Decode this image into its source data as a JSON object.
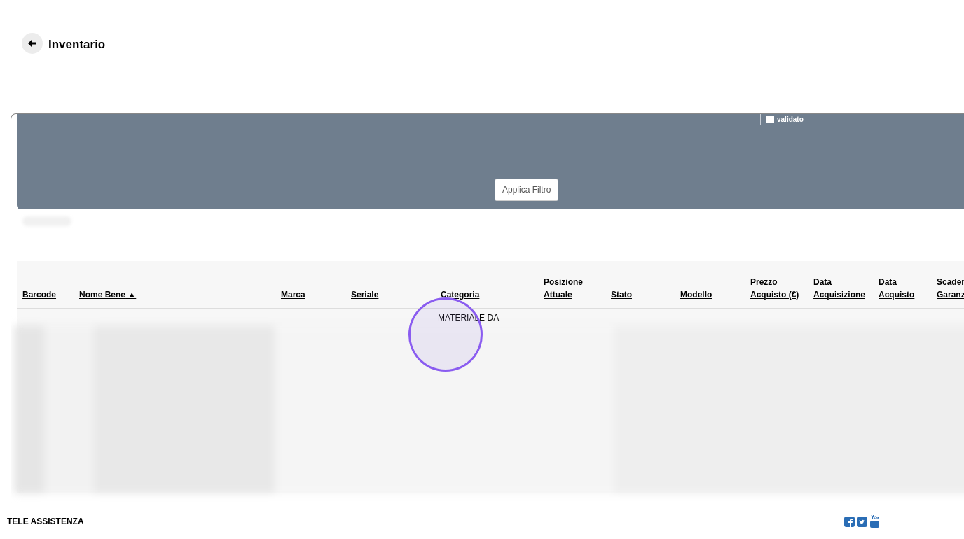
{
  "header": {
    "title": "Inventario"
  },
  "filter": {
    "checkbox": {
      "label": "validato",
      "checked": false
    },
    "apply_button": "Applica Filtro"
  },
  "table": {
    "columns": [
      {
        "lines": [
          "Barcode"
        ]
      },
      {
        "lines": [
          "Nome Bene"
        ],
        "sort_mark": "▲"
      },
      {
        "lines": [
          "Marca"
        ]
      },
      {
        "lines": [
          "Seriale"
        ]
      },
      {
        "lines": [
          "Categoria"
        ],
        "first_row_value": "MATERIALE DA"
      },
      {
        "lines": [
          "Posizione",
          "Attuale"
        ]
      },
      {
        "lines": [
          "Stato"
        ]
      },
      {
        "lines": [
          "Modello"
        ]
      },
      {
        "lines": [
          "Prezzo",
          "Acquisto (€)"
        ]
      },
      {
        "lines": [
          "Data",
          "Acquisizione"
        ]
      },
      {
        "lines": [
          "Data",
          "Acquisto"
        ]
      },
      {
        "lines": [
          "Scader",
          "Garanz"
        ]
      }
    ]
  },
  "footer": {
    "text": "TELE ASSISTENZA"
  }
}
